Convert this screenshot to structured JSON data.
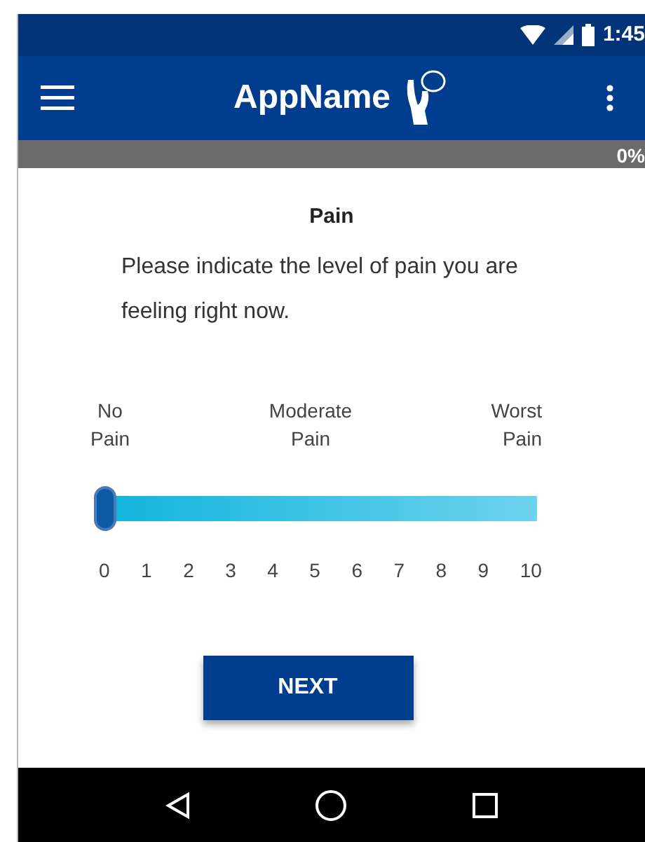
{
  "status_bar": {
    "time": "1:45"
  },
  "app_bar": {
    "title": "AppName"
  },
  "progress": {
    "label": "0%"
  },
  "question": {
    "title": "Pain",
    "text": "Please indicate the level of pain you are feeling right now."
  },
  "slider": {
    "level": 0,
    "anchors": [
      {
        "label": "No Pain"
      },
      {
        "label": "Moderate Pain"
      },
      {
        "label": "Worst Pain"
      }
    ],
    "ticks": [
      "0",
      "1",
      "2",
      "3",
      "4",
      "5",
      "6",
      "7",
      "8",
      "9",
      "10"
    ]
  },
  "buttons": [
    {
      "label": "NEXT"
    }
  ]
}
